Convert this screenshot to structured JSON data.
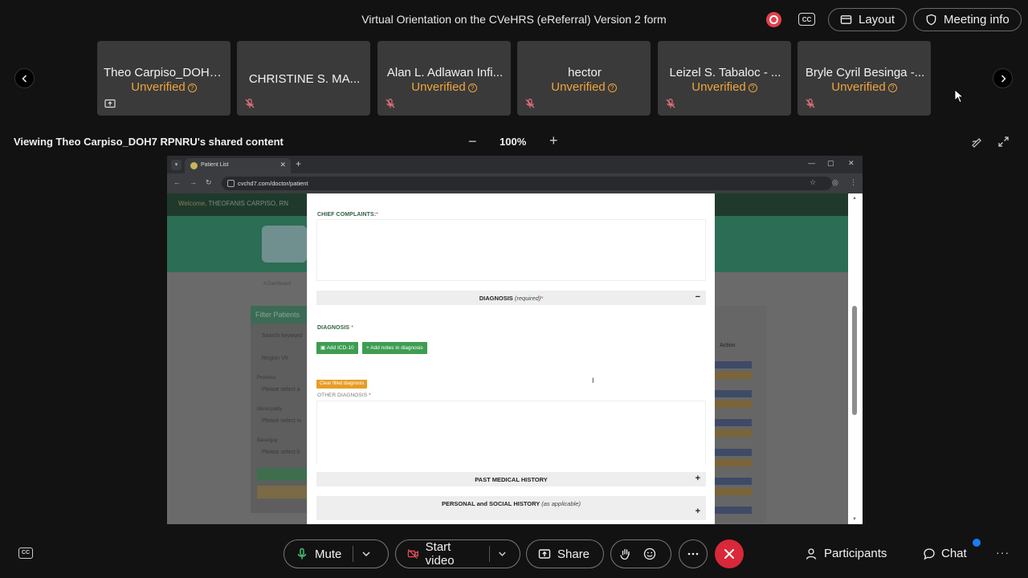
{
  "meeting": {
    "title": "Virtual Orientation on the CVeHRS (eReferral) Version 2 form",
    "cc_label": "CC",
    "layout_label": "Layout",
    "meeting_info_label": "Meeting info"
  },
  "participants": [
    {
      "name": "Theo Carpiso_DOH7...",
      "status": "Unverified",
      "icon": "screen-share-icon"
    },
    {
      "name": "CHRISTINE S. MA...",
      "status": "",
      "icon": "mic-muted-icon"
    },
    {
      "name": "Alan L. Adlawan Infi...",
      "status": "Unverified",
      "icon": "mic-muted-icon"
    },
    {
      "name": "hector",
      "status": "Unverified",
      "icon": "mic-muted-icon"
    },
    {
      "name": "Leizel S. Tabaloc - ...",
      "status": "Unverified",
      "icon": "mic-muted-icon"
    },
    {
      "name": "Bryle Cyril Besinga -...",
      "status": "Unverified",
      "icon": "mic-muted-icon"
    }
  ],
  "share": {
    "viewing_text": "Viewing Theo Carpiso_DOH7 RPNRU's shared content",
    "zoom_minus": "−",
    "zoom": "100%",
    "zoom_plus": "+"
  },
  "browser": {
    "tab_title": "Patient List",
    "url": "cvchd7.com/doctor/patient"
  },
  "page": {
    "welcome": "Welcome,",
    "user": "THEOFANIS CARPISO, RN",
    "breadcrumb": "# Dashboard",
    "filter_title": "Filter Patients",
    "filter_fields": [
      "Search keyword",
      "Region VII",
      "Province",
      "Please select a",
      "Municipality",
      "Please select m",
      "Barangay",
      "Please select b"
    ],
    "action_header": "Action"
  },
  "form": {
    "chief_complaints_label": "CHIEF COMPLAINTS:",
    "req_mark": "*",
    "diagnosis_section_title": "DIAGNOSIS",
    "diagnosis_section_sub": "(required)",
    "collapse_symbol": "−",
    "diagnosis_label": "DIAGNOSIS",
    "add_icd_label": "Add ICD-10",
    "add_notes_label": "Add notes in diagnosis",
    "clear_label": "Clear filled diagnosis",
    "other_diagnosis_label": "OTHER DIAGNOSIS",
    "past_medical_title": "PAST MEDICAL HISTORY",
    "personal_social_title": "PERSONAL and SOCIAL HISTORY",
    "personal_social_sub": "(as applicable)",
    "expand_symbol": "+"
  },
  "toolbar": {
    "cc_label": "CC",
    "mute_label": "Mute",
    "start_video_label": "Start video",
    "share_label": "Share",
    "participants_label": "Participants",
    "chat_label": "Chat",
    "more_label": "···"
  },
  "colors": {
    "unverified": "#f0a53a",
    "end_call": "#d9283a",
    "form_green": "#3e9d52",
    "clear_orange": "#e69d24"
  }
}
